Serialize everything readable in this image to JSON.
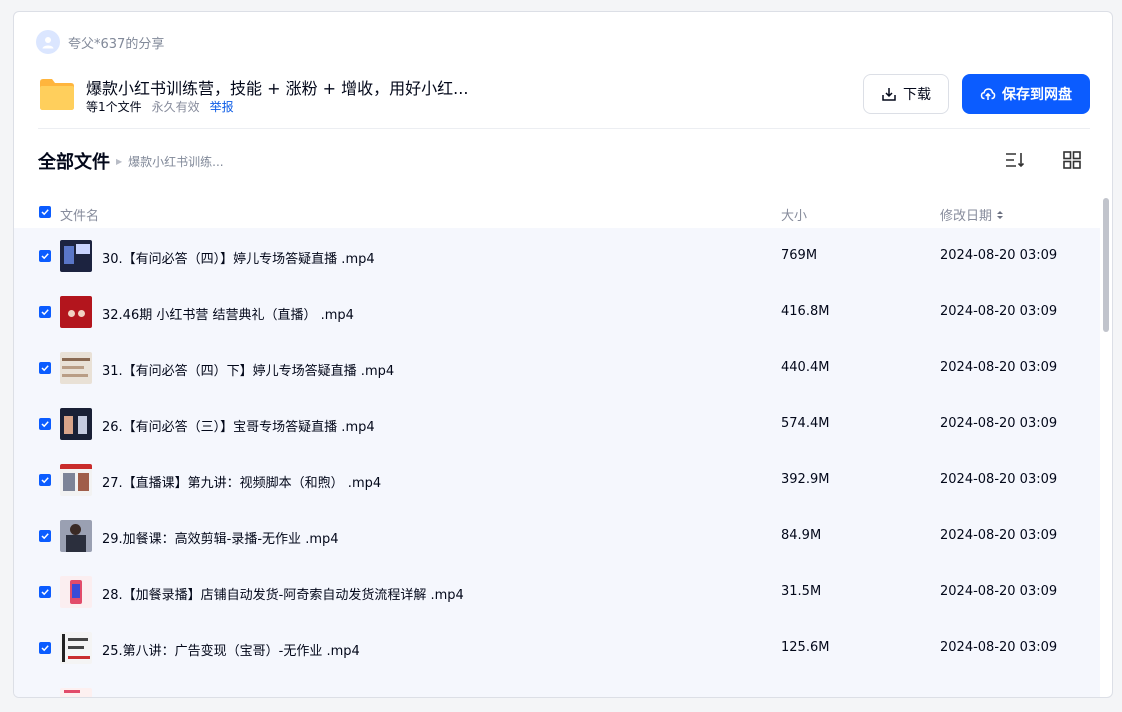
{
  "share": {
    "sharer": "夸父*637的分享",
    "title": "爆款小红书训练营，技能 + 涨粉 + 增收，用好小红...",
    "file_count": "等1个文件",
    "validity": "永久有效",
    "report": "举报"
  },
  "actions": {
    "download": "下载",
    "save": "保存到网盘"
  },
  "breadcrumb": {
    "root": "全部文件",
    "current": "爆款小红书训练..."
  },
  "table": {
    "headers": {
      "name": "文件名",
      "size": "大小",
      "date": "修改日期"
    },
    "rows": [
      {
        "name": "30.【有问必答（四）】婷儿专场答疑直播 .mp4",
        "size": "769M",
        "date": "2024-08-20 03:09"
      },
      {
        "name": "32.46期 小红书营 结营典礼（直播） .mp4",
        "size": "416.8M",
        "date": "2024-08-20 03:09"
      },
      {
        "name": "31.【有问必答（四）下】婷儿专场答疑直播 .mp4",
        "size": "440.4M",
        "date": "2024-08-20 03:09"
      },
      {
        "name": "26.【有问必答（三）】宝哥专场答疑直播 .mp4",
        "size": "574.4M",
        "date": "2024-08-20 03:09"
      },
      {
        "name": "27.【直播课】第九讲：视频脚本（和煦） .mp4",
        "size": "392.9M",
        "date": "2024-08-20 03:09"
      },
      {
        "name": "29.加餐课：高效剪辑-录播-无作业 .mp4",
        "size": "84.9M",
        "date": "2024-08-20 03:09"
      },
      {
        "name": "28.【加餐录播】店铺自动发货-阿奇索自动发货流程详解 .mp4",
        "size": "31.5M",
        "date": "2024-08-20 03:09"
      },
      {
        "name": "25.第八讲：广告变现（宝哥）-无作业 .mp4",
        "size": "125.6M",
        "date": "2024-08-20 03:09"
      }
    ]
  },
  "colors": {
    "accent": "#0b5cff",
    "folder": "#ffc64a",
    "row_bg": "#f5f7fd"
  }
}
